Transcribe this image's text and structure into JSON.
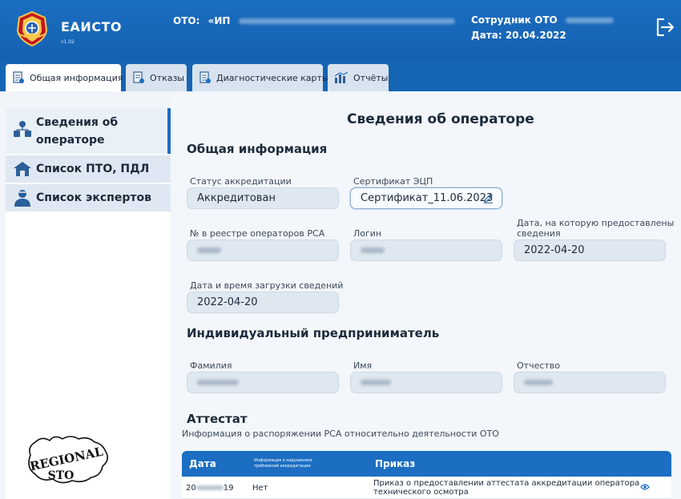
{
  "header": {
    "app_title": "ЕАИСТО",
    "app_version": "v1.02",
    "oto_label": "ОТО:",
    "oto_value_prefix": "«ИП",
    "employee_label": "Сотрудник ОТО",
    "date_label": "Дата:",
    "date_value": "20.04.2022"
  },
  "tabs": [
    {
      "label": "Общая информация",
      "active": true
    },
    {
      "label": "Отказы",
      "active": false
    },
    {
      "label": "Диагностические карты",
      "active": false
    },
    {
      "label": "Отчёты",
      "active": false
    }
  ],
  "sidebar": {
    "items": [
      {
        "label_line1": "Сведения об",
        "label_line2": "операторе",
        "active": true
      },
      {
        "label": "Список ПТО, ПДЛ",
        "active": false
      },
      {
        "label": "Список экспертов",
        "active": false
      }
    ],
    "stamp_top": "REGIONAL",
    "stamp_bottom": "STO"
  },
  "main": {
    "page_title": "Сведения об операторе",
    "general_section": "Общая информация",
    "fields": {
      "accreditation_status_label": "Статус аккредитации",
      "accreditation_status_value": "Аккредитован",
      "certificate_label": "Сертификат ЭЦП",
      "certificate_value": "Сертификат_11.06.2023",
      "rsa_registry_label": "№ в реестре операторов РСА",
      "login_label": "Логин",
      "provided_date_label_line1": "Дата, на которую предоставлены",
      "provided_date_label_line2": "сведения",
      "provided_date_value": "2022-04-20",
      "upload_datetime_label": "Дата и время загрузки сведений",
      "upload_datetime_value": "2022-04-20"
    },
    "ip_section": "Индивидуальный предприниматель",
    "ip_fields": {
      "surname_label": "Фамилия",
      "name_label": "Имя",
      "patronymic_label": "Отчество"
    },
    "attestat_section": "Аттестат",
    "attestat_subtitle": "Информация о распоряжении РСА относительно деятельности ОТО",
    "table": {
      "columns": {
        "date": "Дата",
        "violations_line1": "Информация о нарушениях",
        "violations_line2": "требований аккредитации",
        "order": "Приказ"
      },
      "rows": [
        {
          "date_prefix": "20",
          "date_suffix": "19",
          "violations": "Нет",
          "order_line1": "Приказ о предоставлении аттестата аккредитации оператора",
          "order_line2": "технического осмотра"
        }
      ]
    }
  },
  "colors": {
    "header_blue": "#1b6ec2",
    "tab_inactive": "#d8e3ef",
    "field_bg": "#dfe7f0"
  }
}
